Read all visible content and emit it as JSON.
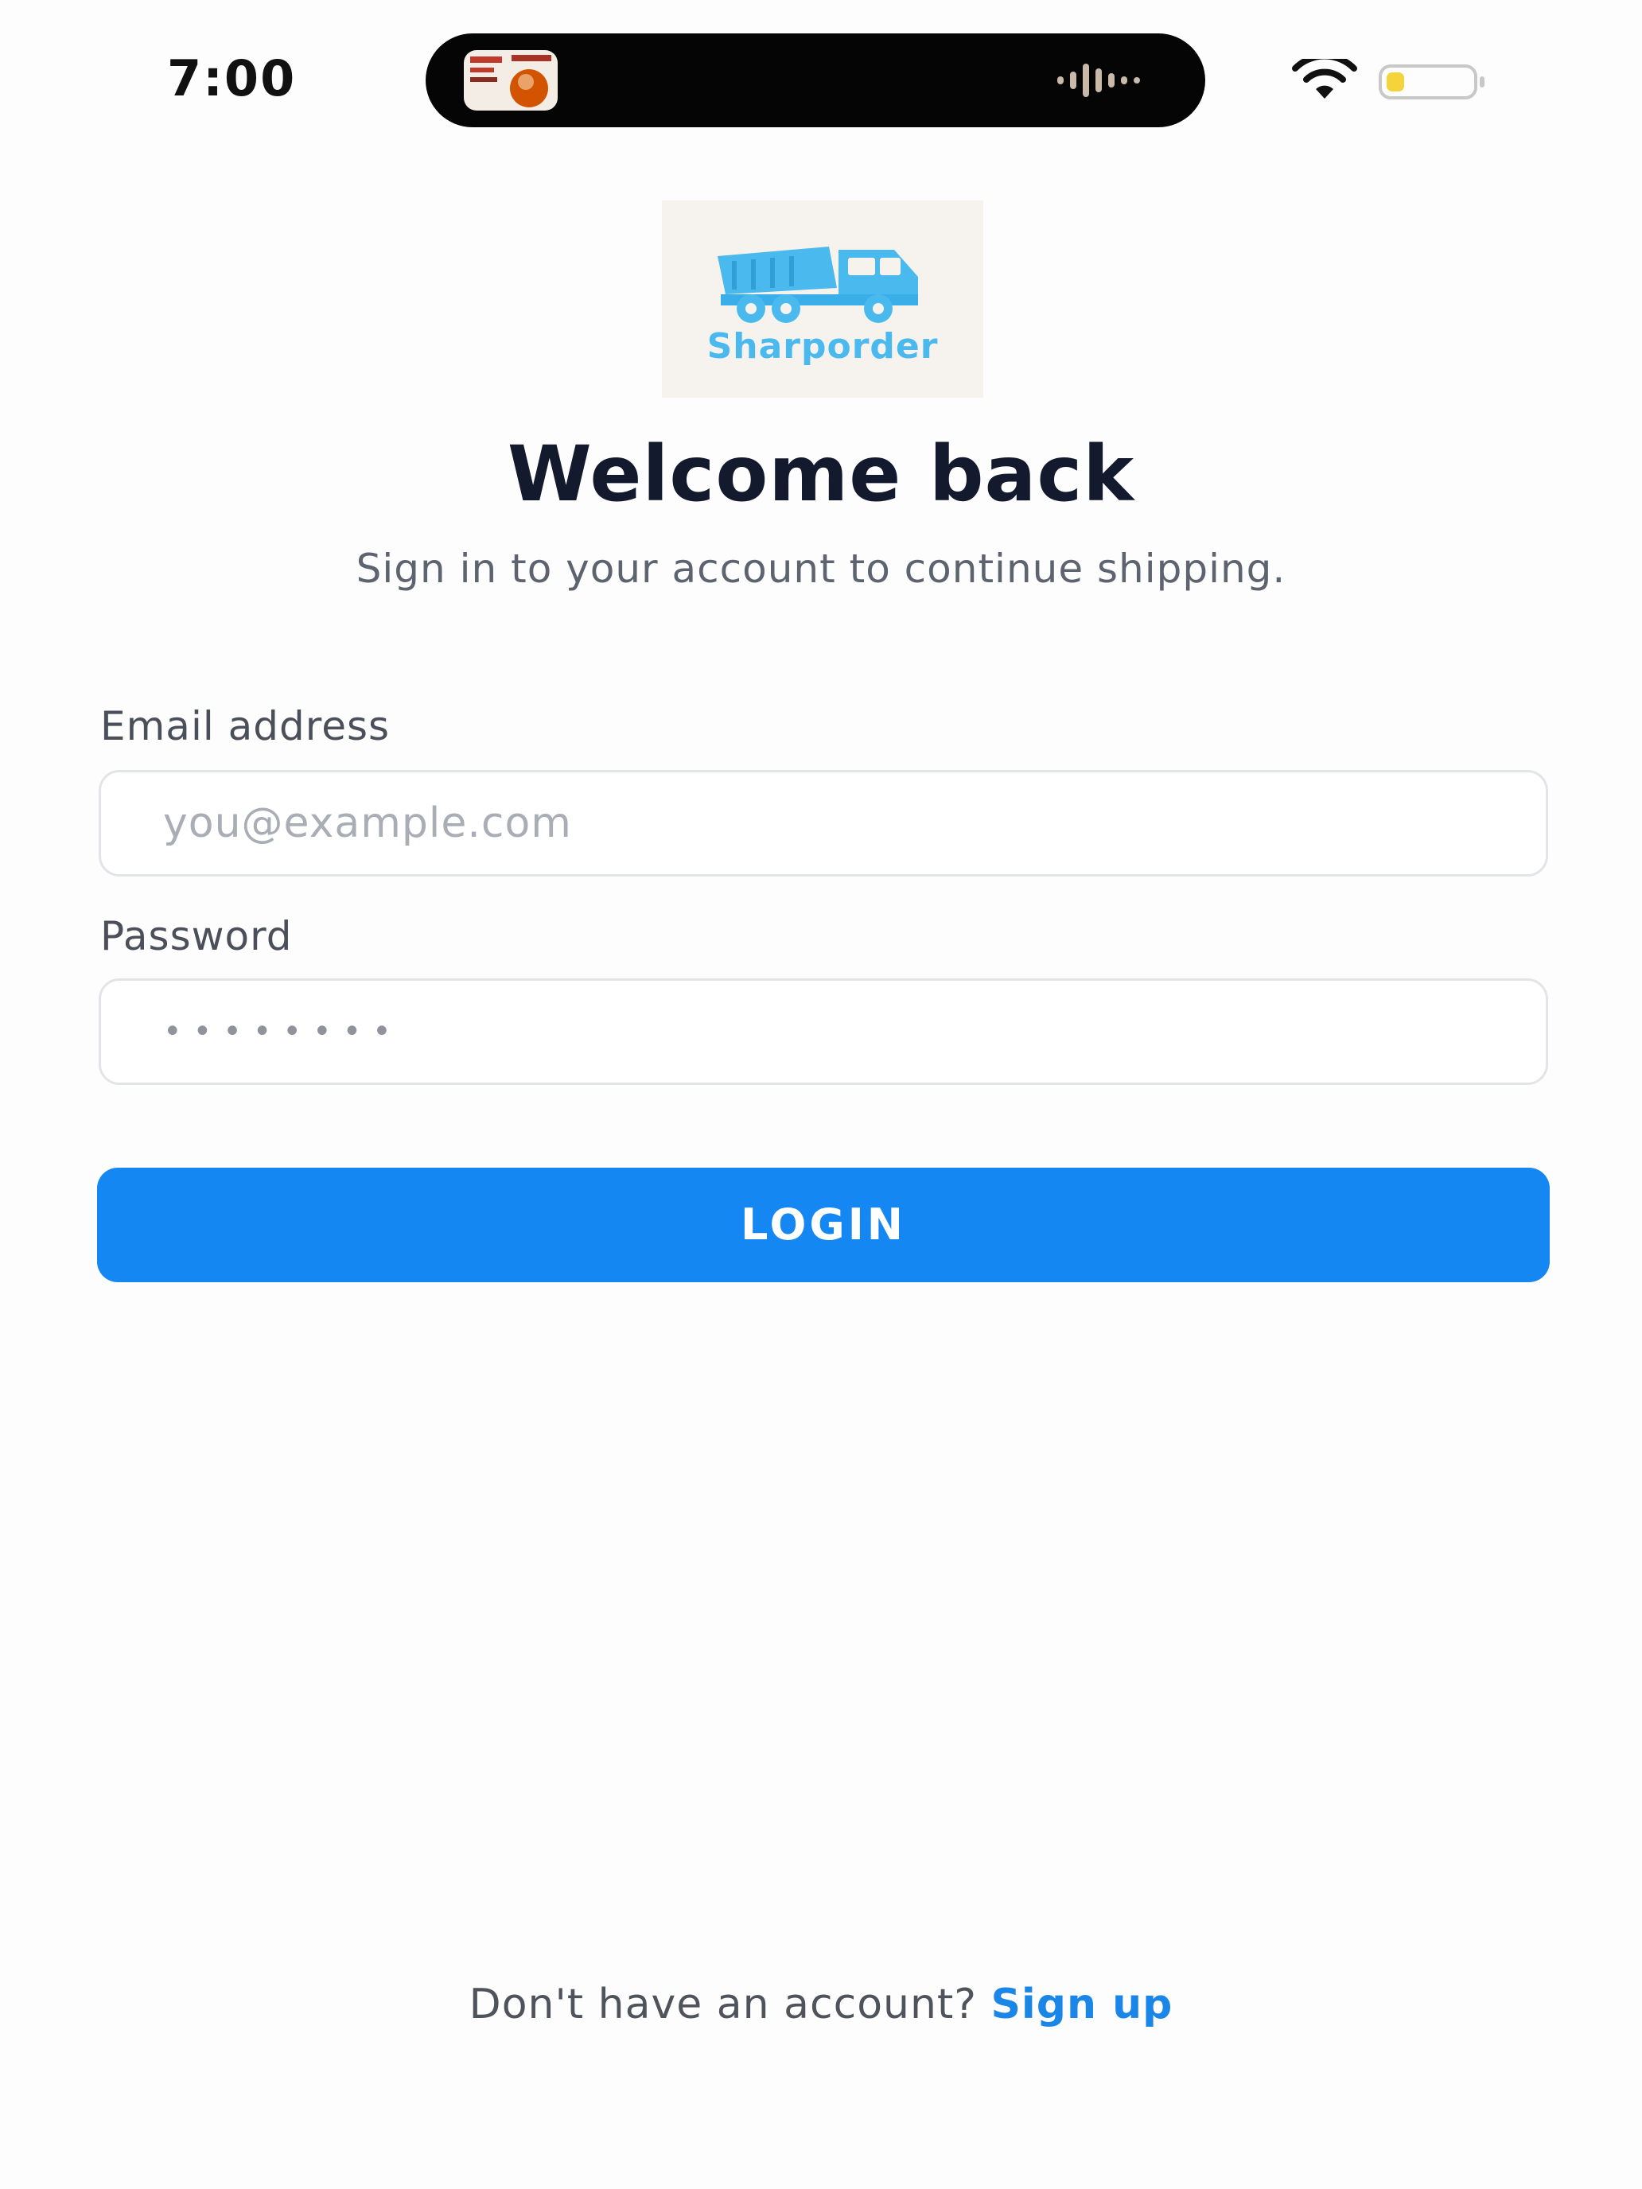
{
  "status_bar": {
    "time": "7:00",
    "wifi_icon": "wifi-icon",
    "battery_icon": "battery-low-icon",
    "battery_color": "#f5d33a"
  },
  "logo": {
    "icon": "dump-truck-icon",
    "brand": "Sharporder",
    "color": "#4ab9ee"
  },
  "header": {
    "title": "Welcome back",
    "subtitle": "Sign in to your account to continue shipping."
  },
  "form": {
    "email": {
      "label": "Email address",
      "placeholder": "you@example.com",
      "value": ""
    },
    "password": {
      "label": "Password",
      "placeholder": "••••••••",
      "value": ""
    },
    "login_label": "LOGIN",
    "accent_color": "#1587f2"
  },
  "footer": {
    "prompt": "Don't have an account?",
    "signup_label": "Sign up"
  }
}
